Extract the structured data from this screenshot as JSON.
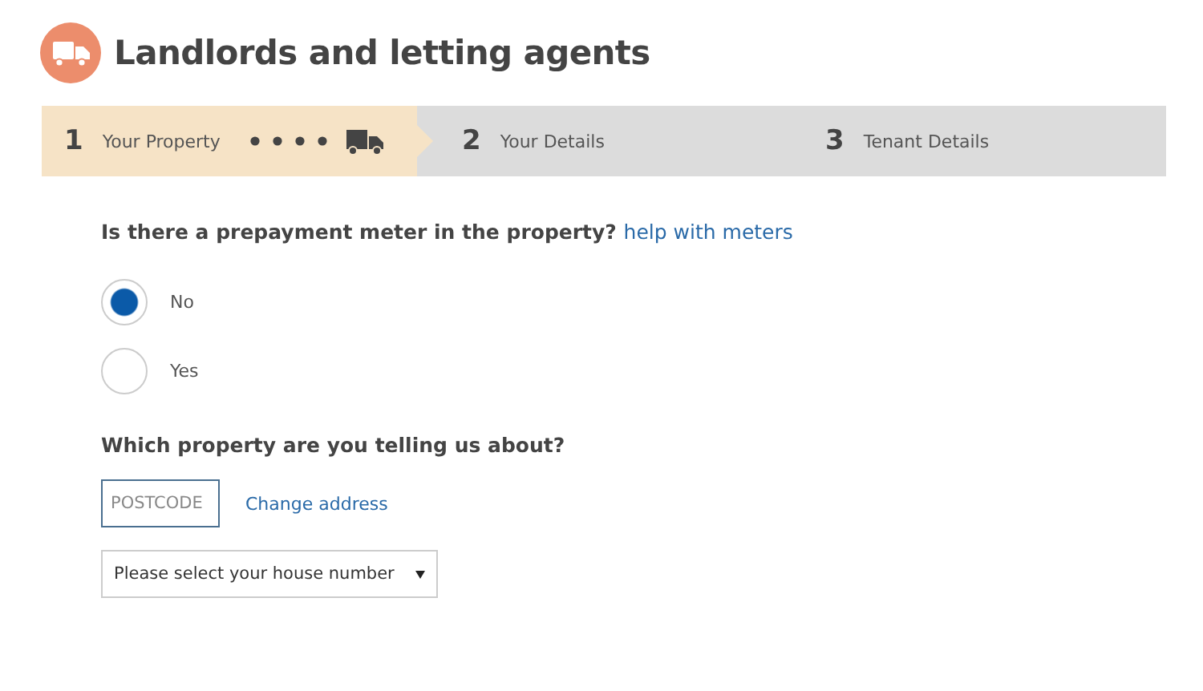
{
  "header": {
    "title": "Landlords and letting agents"
  },
  "steps": [
    {
      "number": "1",
      "label": "Your Property",
      "selected": true
    },
    {
      "number": "2",
      "label": "Your Details",
      "selected": false
    },
    {
      "number": "3",
      "label": "Tenant Details",
      "selected": false
    }
  ],
  "meter_question": {
    "text": "Is there a prepayment meter in the property?",
    "link": "help with meters",
    "options": [
      {
        "label": "No",
        "selected": true
      },
      {
        "label": "Yes",
        "selected": false
      }
    ]
  },
  "property_question": {
    "text": "Which property are you telling us about?",
    "postcode": {
      "placeholder": "POSTCODE"
    },
    "change_link": "Change address",
    "house_select": {
      "value": "Please select your house number"
    }
  }
}
